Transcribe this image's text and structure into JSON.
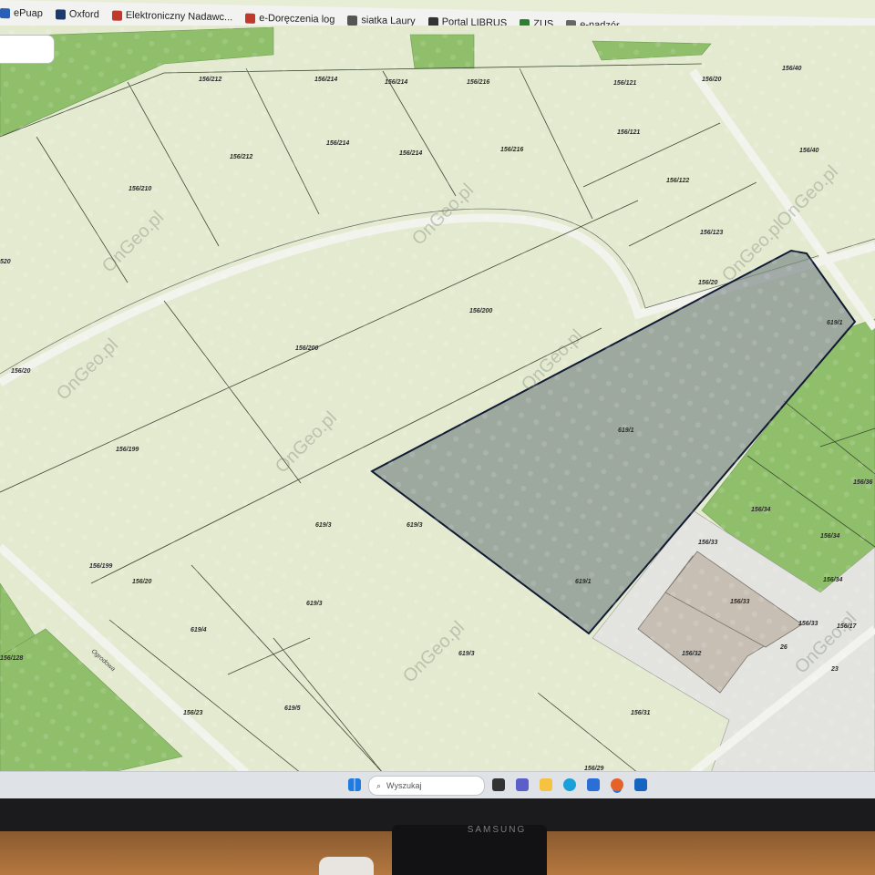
{
  "bookmarks": [
    {
      "label": "ePuap",
      "icon": "epuap-icon",
      "color": "#2a5fb8"
    },
    {
      "label": "Oxford",
      "icon": "oxford-icon",
      "color": "#1c3a6e"
    },
    {
      "label": "Elektroniczny Nadawc...",
      "icon": "poczta-icon",
      "color": "#c0392b"
    },
    {
      "label": "e-Doręczenia log",
      "icon": "edoreczenia-icon",
      "color": "#c0392b"
    },
    {
      "label": "siatka Laury",
      "icon": "s-circle-icon",
      "color": "#555555"
    },
    {
      "label": "Portal LIBRUS",
      "icon": "librus-icon",
      "color": "#333333"
    },
    {
      "label": "ZUS",
      "icon": "zus-icon",
      "color": "#2f7d32"
    },
    {
      "label": "e-nadzór",
      "icon": "enadzor-icon",
      "color": "#666666"
    }
  ],
  "watermark": "OnGeo.pl",
  "parcels": [
    {
      "id": "p-156-212-a",
      "label": "156/212"
    },
    {
      "id": "p-156-214-a",
      "label": "156/214"
    },
    {
      "id": "p-156-214-b",
      "label": "156/214"
    },
    {
      "id": "p-156-216-a",
      "label": "156/216"
    },
    {
      "id": "p-156-121-a",
      "label": "156/121"
    },
    {
      "id": "p-156-20-a",
      "label": "156/20"
    },
    {
      "id": "p-156-40-a",
      "label": "156/40"
    },
    {
      "id": "p-156-214-c",
      "label": "156/214"
    },
    {
      "id": "p-156-212-b",
      "label": "156/212"
    },
    {
      "id": "p-156-214-d",
      "label": "156/214"
    },
    {
      "id": "p-156-216-b",
      "label": "156/216"
    },
    {
      "id": "p-156-121-b",
      "label": "156/121"
    },
    {
      "id": "p-156-40-b",
      "label": "156/40"
    },
    {
      "id": "p-156-210",
      "label": "156/210"
    },
    {
      "id": "p-156-122",
      "label": "156/122"
    },
    {
      "id": "p-156-123",
      "label": "156/123"
    },
    {
      "id": "p-520",
      "label": "520"
    },
    {
      "id": "p-156-20-b",
      "label": "156/20"
    },
    {
      "id": "p-156-200-a",
      "label": "156/200"
    },
    {
      "id": "p-156-200-b",
      "label": "156/200"
    },
    {
      "id": "p-619-1-a",
      "label": "619/1"
    },
    {
      "id": "p-156-20-c",
      "label": "156/20"
    },
    {
      "id": "p-156-199-a",
      "label": "156/199"
    },
    {
      "id": "p-619-1-b",
      "label": "619/1"
    },
    {
      "id": "p-156-36",
      "label": "156/36"
    },
    {
      "id": "p-619-3-a",
      "label": "619/3"
    },
    {
      "id": "p-619-3-b",
      "label": "619/3"
    },
    {
      "id": "p-156-34-a",
      "label": "156/34"
    },
    {
      "id": "p-156-34-b",
      "label": "156/34"
    },
    {
      "id": "p-156-199-b",
      "label": "156/199"
    },
    {
      "id": "p-156-20-d",
      "label": "156/20"
    },
    {
      "id": "p-156-33-a",
      "label": "156/33"
    },
    {
      "id": "p-619-1-c",
      "label": "619/1"
    },
    {
      "id": "p-156-34-c",
      "label": "156/34"
    },
    {
      "id": "p-619-3-c",
      "label": "619/3"
    },
    {
      "id": "p-156-33-b",
      "label": "156/33"
    },
    {
      "id": "p-156-33-c",
      "label": "156/33"
    },
    {
      "id": "p-156-17",
      "label": "156/17"
    },
    {
      "id": "p-619-4",
      "label": "619/4"
    },
    {
      "id": "p-156-32",
      "label": "156/32"
    },
    {
      "id": "p-26",
      "label": "26"
    },
    {
      "id": "p-156-128",
      "label": "156/128"
    },
    {
      "id": "p-619-3-d",
      "label": "619/3"
    },
    {
      "id": "p-23",
      "label": "23"
    },
    {
      "id": "p-156-23",
      "label": "156/23"
    },
    {
      "id": "p-619-5",
      "label": "619/5"
    },
    {
      "id": "p-156-31",
      "label": "156/31"
    },
    {
      "id": "p-156-29",
      "label": "156/29"
    }
  ],
  "street_label": "Ogrodowa",
  "taskbar": {
    "search_placeholder": "Wyszukaj"
  },
  "monitor_brand": "SAMSUNG",
  "colors": {
    "field": "#e4ead0",
    "field_alt": "#d9e3c2",
    "green_field": "#8fbf6a",
    "highlight_fill": "#7f8c8a",
    "highlight_stroke": "#111a33",
    "road": "#f3f3ee",
    "building": "#c7bfb4"
  }
}
